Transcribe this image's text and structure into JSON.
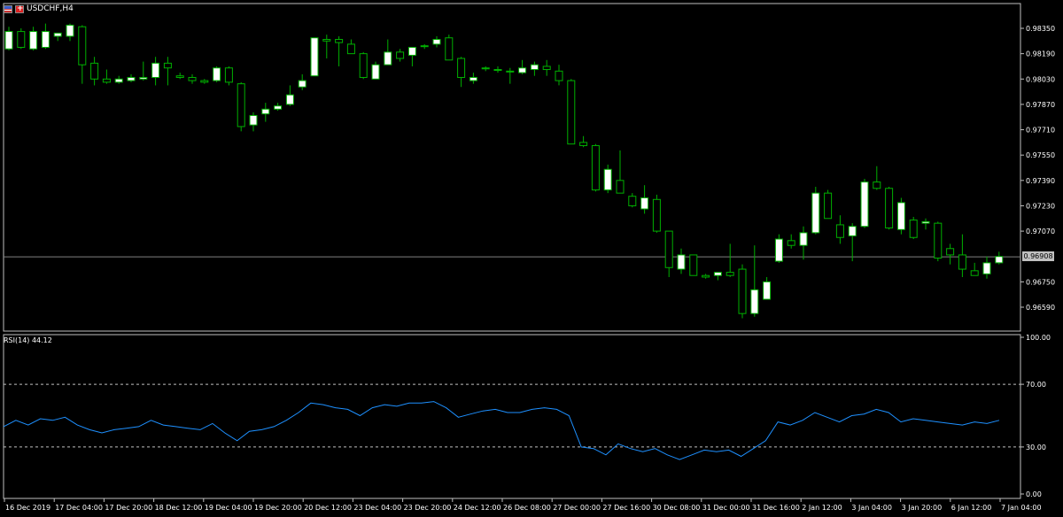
{
  "window": {
    "symbol_title": "USDCHF,H4",
    "flags": [
      "us-flag-icon",
      "ch-flag-icon"
    ]
  },
  "colors": {
    "background": "#000000",
    "frame": "#c0c0c0",
    "bull_body": "#ffffff",
    "bear_body": "#000000",
    "wick": "#00b000",
    "rsi_line": "#1e90ff",
    "level_line": "#c0c0c0",
    "current_price_line": "#808080"
  },
  "price_axis": {
    "labels": [
      "0.98350",
      "0.98190",
      "0.98030",
      "0.97870",
      "0.97710",
      "0.97550",
      "0.97390",
      "0.97230",
      "0.97070",
      "0.96750",
      "0.96590"
    ],
    "current_price": "0.96908"
  },
  "rsi": {
    "label": "RSI(14) 44.12",
    "axis_labels": [
      "100.00",
      "70.00",
      "30.00",
      "0.00"
    ],
    "levels": [
      70,
      30
    ],
    "values": [
      43,
      47,
      44,
      48,
      47,
      49,
      44,
      41,
      39,
      41,
      42,
      43,
      47,
      44,
      43,
      42,
      41,
      45,
      39,
      34,
      40,
      41,
      43,
      47,
      52,
      58,
      57,
      55,
      54,
      50,
      55,
      57,
      56,
      58,
      58,
      59,
      55,
      49,
      51,
      53,
      54,
      52,
      52,
      54,
      55,
      54,
      50,
      30,
      29,
      25,
      32,
      29,
      27,
      29,
      25,
      22,
      25,
      28,
      27,
      28,
      24,
      29,
      34,
      46,
      44,
      47,
      52,
      49,
      46,
      50,
      51,
      54,
      52,
      46,
      48,
      47,
      46,
      45,
      44,
      46,
      45,
      47
    ]
  },
  "time_axis": {
    "labels": [
      "16 Dec 2019",
      "17 Dec 04:00",
      "17 Dec 20:00",
      "18 Dec 12:00",
      "19 Dec 04:00",
      "19 Dec 20:00",
      "20 Dec 12:00",
      "23 Dec 04:00",
      "23 Dec 20:00",
      "24 Dec 12:00",
      "26 Dec 08:00",
      "27 Dec 00:00",
      "27 Dec 16:00",
      "30 Dec 08:00",
      "31 Dec 00:00",
      "31 Dec 16:00",
      "2 Jan 12:00",
      "3 Jan 04:00",
      "3 Jan 20:00",
      "6 Jan 12:00",
      "7 Jan 04:00"
    ]
  },
  "chart_data": {
    "type": "candlestick",
    "symbol": "USDCHF",
    "timeframe": "H4",
    "price_range": [
      0.9651,
      0.9845
    ],
    "current_price": 0.96908,
    "candles": [
      {
        "o": 0.9822,
        "h": 0.9836,
        "l": 0.9821,
        "c": 0.9833
      },
      {
        "o": 0.9833,
        "h": 0.9835,
        "l": 0.9822,
        "c": 0.9823
      },
      {
        "o": 0.9822,
        "h": 0.9836,
        "l": 0.9821,
        "c": 0.9833
      },
      {
        "o": 0.9823,
        "h": 0.9838,
        "l": 0.9822,
        "c": 0.9833
      },
      {
        "o": 0.983,
        "h": 0.9832,
        "l": 0.9827,
        "c": 0.9832
      },
      {
        "o": 0.983,
        "h": 0.9838,
        "l": 0.9827,
        "c": 0.9837
      },
      {
        "o": 0.9836,
        "h": 0.9837,
        "l": 0.98,
        "c": 0.9812
      },
      {
        "o": 0.9813,
        "h": 0.9817,
        "l": 0.9799,
        "c": 0.9803
      },
      {
        "o": 0.9803,
        "h": 0.9809,
        "l": 0.98,
        "c": 0.9801
      },
      {
        "o": 0.9801,
        "h": 0.9805,
        "l": 0.98,
        "c": 0.9803
      },
      {
        "o": 0.9802,
        "h": 0.9806,
        "l": 0.9801,
        "c": 0.9804
      },
      {
        "o": 0.9803,
        "h": 0.9814,
        "l": 0.9802,
        "c": 0.9804
      },
      {
        "o": 0.9804,
        "h": 0.9817,
        "l": 0.9799,
        "c": 0.9813
      },
      {
        "o": 0.9813,
        "h": 0.9817,
        "l": 0.9799,
        "c": 0.981
      },
      {
        "o": 0.9805,
        "h": 0.9807,
        "l": 0.9803,
        "c": 0.9804
      },
      {
        "o": 0.9804,
        "h": 0.9806,
        "l": 0.98,
        "c": 0.9802
      },
      {
        "o": 0.9802,
        "h": 0.9803,
        "l": 0.98,
        "c": 0.9801
      },
      {
        "o": 0.9802,
        "h": 0.9811,
        "l": 0.9801,
        "c": 0.981
      },
      {
        "o": 0.981,
        "h": 0.9811,
        "l": 0.9799,
        "c": 0.9801
      },
      {
        "o": 0.98,
        "h": 0.9801,
        "l": 0.977,
        "c": 0.9773
      },
      {
        "o": 0.9774,
        "h": 0.9782,
        "l": 0.977,
        "c": 0.978
      },
      {
        "o": 0.9781,
        "h": 0.9788,
        "l": 0.9776,
        "c": 0.9784
      },
      {
        "o": 0.9784,
        "h": 0.9788,
        "l": 0.9783,
        "c": 0.9786
      },
      {
        "o": 0.9787,
        "h": 0.9799,
        "l": 0.9786,
        "c": 0.9793
      },
      {
        "o": 0.9798,
        "h": 0.9806,
        "l": 0.9796,
        "c": 0.9802
      },
      {
        "o": 0.9805,
        "h": 0.9829,
        "l": 0.9805,
        "c": 0.9829
      },
      {
        "o": 0.9828,
        "h": 0.9831,
        "l": 0.9816,
        "c": 0.9827
      },
      {
        "o": 0.9828,
        "h": 0.983,
        "l": 0.9811,
        "c": 0.9826
      },
      {
        "o": 0.9825,
        "h": 0.9828,
        "l": 0.982,
        "c": 0.9819
      },
      {
        "o": 0.9819,
        "h": 0.982,
        "l": 0.9803,
        "c": 0.9804
      },
      {
        "o": 0.9803,
        "h": 0.9814,
        "l": 0.9803,
        "c": 0.9812
      },
      {
        "o": 0.9812,
        "h": 0.9828,
        "l": 0.9812,
        "c": 0.982
      },
      {
        "o": 0.982,
        "h": 0.9822,
        "l": 0.9814,
        "c": 0.9816
      },
      {
        "o": 0.9818,
        "h": 0.9822,
        "l": 0.9811,
        "c": 0.9823
      },
      {
        "o": 0.9824,
        "h": 0.9825,
        "l": 0.9822,
        "c": 0.9824
      },
      {
        "o": 0.9825,
        "h": 0.983,
        "l": 0.9823,
        "c": 0.9828
      },
      {
        "o": 0.9829,
        "h": 0.9831,
        "l": 0.9821,
        "c": 0.9815
      },
      {
        "o": 0.9816,
        "h": 0.9817,
        "l": 0.9798,
        "c": 0.9804
      },
      {
        "o": 0.9802,
        "h": 0.9807,
        "l": 0.98,
        "c": 0.9804
      },
      {
        "o": 0.981,
        "h": 0.9811,
        "l": 0.9808,
        "c": 0.981
      },
      {
        "o": 0.9809,
        "h": 0.9811,
        "l": 0.9807,
        "c": 0.9809
      },
      {
        "o": 0.9808,
        "h": 0.981,
        "l": 0.98,
        "c": 0.9808
      },
      {
        "o": 0.9807,
        "h": 0.9815,
        "l": 0.9806,
        "c": 0.981
      },
      {
        "o": 0.9809,
        "h": 0.9814,
        "l": 0.9805,
        "c": 0.9812
      },
      {
        "o": 0.9811,
        "h": 0.9815,
        "l": 0.9805,
        "c": 0.9809
      },
      {
        "o": 0.9808,
        "h": 0.9812,
        "l": 0.9799,
        "c": 0.9802
      },
      {
        "o": 0.9802,
        "h": 0.9803,
        "l": 0.9762,
        "c": 0.9762
      },
      {
        "o": 0.9763,
        "h": 0.9767,
        "l": 0.976,
        "c": 0.9761
      },
      {
        "o": 0.9761,
        "h": 0.9762,
        "l": 0.9732,
        "c": 0.9733
      },
      {
        "o": 0.9733,
        "h": 0.9749,
        "l": 0.9731,
        "c": 0.9746
      },
      {
        "o": 0.9739,
        "h": 0.9758,
        "l": 0.9732,
        "c": 0.9731
      },
      {
        "o": 0.9729,
        "h": 0.9731,
        "l": 0.9722,
        "c": 0.9723
      },
      {
        "o": 0.9721,
        "h": 0.9736,
        "l": 0.9718,
        "c": 0.9728
      },
      {
        "o": 0.9727,
        "h": 0.973,
        "l": 0.9706,
        "c": 0.9707
      },
      {
        "o": 0.9707,
        "h": 0.9707,
        "l": 0.9678,
        "c": 0.9684
      },
      {
        "o": 0.9683,
        "h": 0.9696,
        "l": 0.968,
        "c": 0.9692
      },
      {
        "o": 0.9692,
        "h": 0.9692,
        "l": 0.9679,
        "c": 0.9679
      },
      {
        "o": 0.9679,
        "h": 0.968,
        "l": 0.9677,
        "c": 0.9678
      },
      {
        "o": 0.9679,
        "h": 0.968,
        "l": 0.9676,
        "c": 0.9681
      },
      {
        "o": 0.9681,
        "h": 0.9699,
        "l": 0.9678,
        "c": 0.9679
      },
      {
        "o": 0.9683,
        "h": 0.9686,
        "l": 0.9652,
        "c": 0.9655
      },
      {
        "o": 0.9655,
        "h": 0.9698,
        "l": 0.9653,
        "c": 0.967
      },
      {
        "o": 0.9664,
        "h": 0.9678,
        "l": 0.9664,
        "c": 0.9675
      },
      {
        "o": 0.9688,
        "h": 0.9705,
        "l": 0.9687,
        "c": 0.9702
      },
      {
        "o": 0.9701,
        "h": 0.9705,
        "l": 0.9696,
        "c": 0.9698
      },
      {
        "o": 0.9698,
        "h": 0.971,
        "l": 0.9689,
        "c": 0.9706
      },
      {
        "o": 0.9706,
        "h": 0.9735,
        "l": 0.9705,
        "c": 0.9731
      },
      {
        "o": 0.9731,
        "h": 0.9733,
        "l": 0.9715,
        "c": 0.9715
      },
      {
        "o": 0.9711,
        "h": 0.9717,
        "l": 0.9699,
        "c": 0.9703
      },
      {
        "o": 0.9704,
        "h": 0.9712,
        "l": 0.9688,
        "c": 0.971
      },
      {
        "o": 0.971,
        "h": 0.974,
        "l": 0.9709,
        "c": 0.9738
      },
      {
        "o": 0.9738,
        "h": 0.9748,
        "l": 0.9733,
        "c": 0.9734
      },
      {
        "o": 0.9734,
        "h": 0.9735,
        "l": 0.9708,
        "c": 0.9709
      },
      {
        "o": 0.9708,
        "h": 0.9728,
        "l": 0.9705,
        "c": 0.9725
      },
      {
        "o": 0.9714,
        "h": 0.9716,
        "l": 0.9702,
        "c": 0.9703
      },
      {
        "o": 0.9712,
        "h": 0.9715,
        "l": 0.9708,
        "c": 0.9713
      },
      {
        "o": 0.9712,
        "h": 0.9713,
        "l": 0.9688,
        "c": 0.969
      },
      {
        "o": 0.9696,
        "h": 0.9699,
        "l": 0.9686,
        "c": 0.9692
      },
      {
        "o": 0.9692,
        "h": 0.9705,
        "l": 0.9678,
        "c": 0.9683
      },
      {
        "o": 0.9682,
        "h": 0.9687,
        "l": 0.9679,
        "c": 0.9679
      },
      {
        "o": 0.968,
        "h": 0.9691,
        "l": 0.9677,
        "c": 0.9687
      },
      {
        "o": 0.9687,
        "h": 0.9694,
        "l": 0.9686,
        "c": 0.9691
      }
    ],
    "indicator": {
      "name": "RSI(14)",
      "last_value": 44.12,
      "ylim": [
        0,
        100
      ],
      "levels": [
        70,
        30
      ]
    }
  }
}
